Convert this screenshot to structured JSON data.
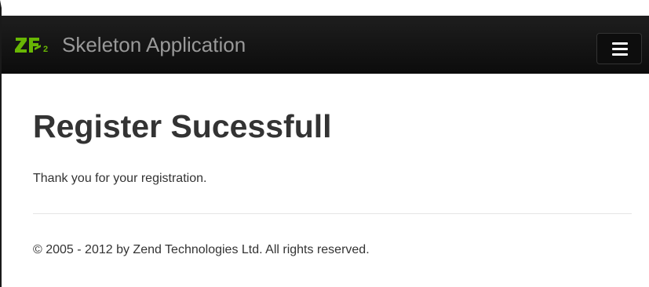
{
  "navbar": {
    "brand_title": "Skeleton Application",
    "logo_icon": "zend-framework-2-logo",
    "logo_text": "ZF2",
    "menu_icon": "hamburger-menu-icon",
    "background_color": "#111111",
    "logo_color": "#68b604"
  },
  "main": {
    "title": "Register Sucessfull",
    "message": "Thank you for your registration."
  },
  "footer": {
    "text": "© 2005 - 2012 by Zend Technologies Ltd. All rights reserved."
  }
}
